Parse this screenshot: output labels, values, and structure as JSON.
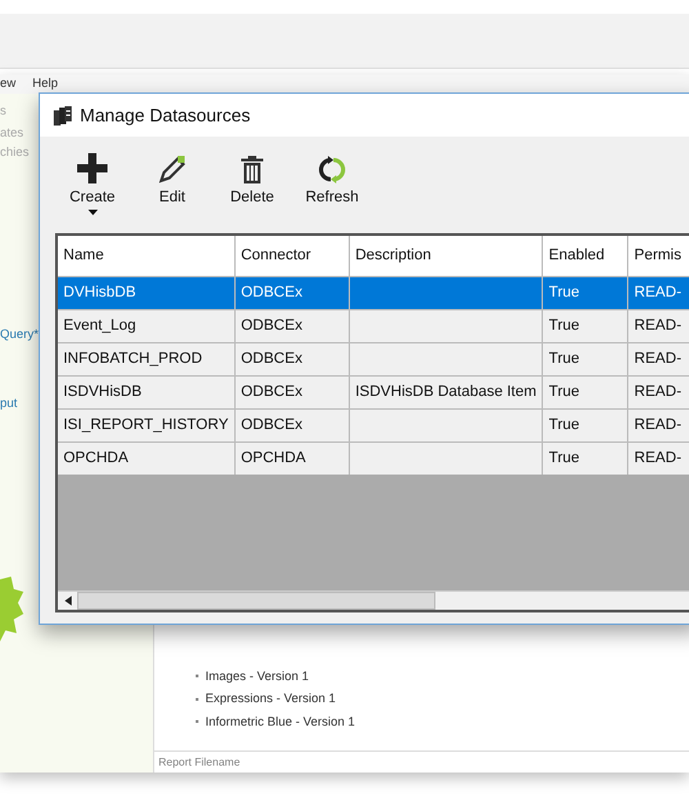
{
  "background_app": {
    "menu": [
      "ew",
      "Help"
    ],
    "side_items": [
      "s",
      "ates",
      "chies"
    ],
    "side_links": [
      "Query*",
      "put"
    ],
    "list_items": [
      "Images - Version 1",
      "Expressions - Version 1",
      "Informetric Blue - Version 1"
    ],
    "field": {
      "placeholder": "Report Filename"
    }
  },
  "dialog": {
    "title": "Manage Datasources",
    "toolbar": [
      {
        "kind": "create",
        "label": "Create"
      },
      {
        "kind": "edit",
        "label": "Edit"
      },
      {
        "kind": "delete",
        "label": "Delete"
      },
      {
        "kind": "refresh",
        "label": "Refresh"
      }
    ],
    "table": {
      "columns": [
        "Name",
        "Connector",
        "Description",
        "Enabled",
        "Permis"
      ],
      "rows": [
        {
          "selected": true,
          "cells": [
            "DVHisbDB",
            "ODBCEx",
            "",
            "True",
            "READ-"
          ]
        },
        {
          "selected": false,
          "cells": [
            "Event_Log",
            "ODBCEx",
            "",
            "True",
            "READ-"
          ]
        },
        {
          "selected": false,
          "cells": [
            "INFOBATCH_PROD",
            "ODBCEx",
            "",
            "True",
            "READ-"
          ]
        },
        {
          "selected": false,
          "cells": [
            "ISDVHisDB",
            "ODBCEx",
            "ISDVHisDB Database Item",
            "True",
            "READ-"
          ]
        },
        {
          "selected": false,
          "cells": [
            "ISI_REPORT_HISTORY",
            "ODBCEx",
            "",
            "True",
            "READ-"
          ]
        },
        {
          "selected": false,
          "cells": [
            "OPCHDA",
            "OPCHDA",
            "",
            "True",
            "READ-"
          ]
        }
      ]
    }
  }
}
